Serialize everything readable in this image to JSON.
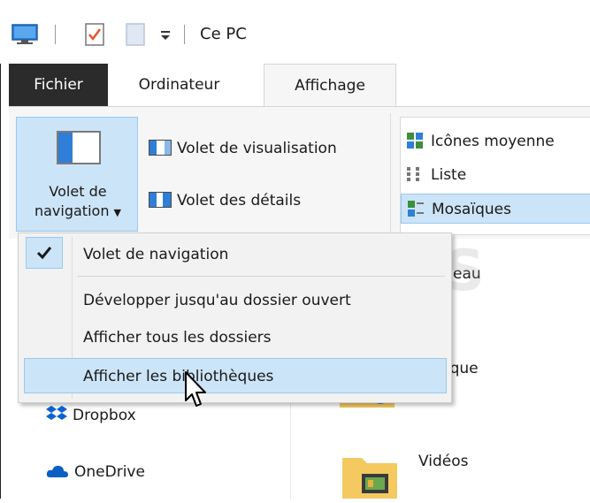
{
  "window": {
    "title": "Ce PC"
  },
  "tabs": {
    "fichier": "Fichier",
    "ordinateur": "Ordinateur",
    "affichage": "Affichage"
  },
  "ribbon": {
    "nav_pane_label_line1": "Volet de",
    "nav_pane_label_line2": "navigation",
    "preview_pane": "Volet de visualisation",
    "details_pane": "Volet des détails",
    "layout": {
      "items": [
        "Icônes moyenne",
        "Liste",
        "Mosaïques"
      ],
      "selected": "Mosaïques"
    }
  },
  "nav_menu": {
    "items": [
      {
        "label": "Volet de navigation",
        "checked": true
      },
      {
        "label": "Développer jusqu'au dossier ouvert",
        "checked": false
      },
      {
        "label": "Afficher tous les dossiers",
        "checked": false
      },
      {
        "label": "Afficher les bibliothèques",
        "checked": false,
        "hovered": true
      }
    ]
  },
  "tree": {
    "dropbox": "Dropbox",
    "onedrive": "OneDrive"
  },
  "folders": {
    "partial1": "eau",
    "partial2": "sique",
    "videos": "Vidéos"
  },
  "watermark": "PCASTUCES",
  "colors": {
    "accent": "#2f7fd8",
    "selection": "#cce4f7",
    "selection_border": "#99c9ef",
    "file_tab": "#2b2b2b"
  }
}
